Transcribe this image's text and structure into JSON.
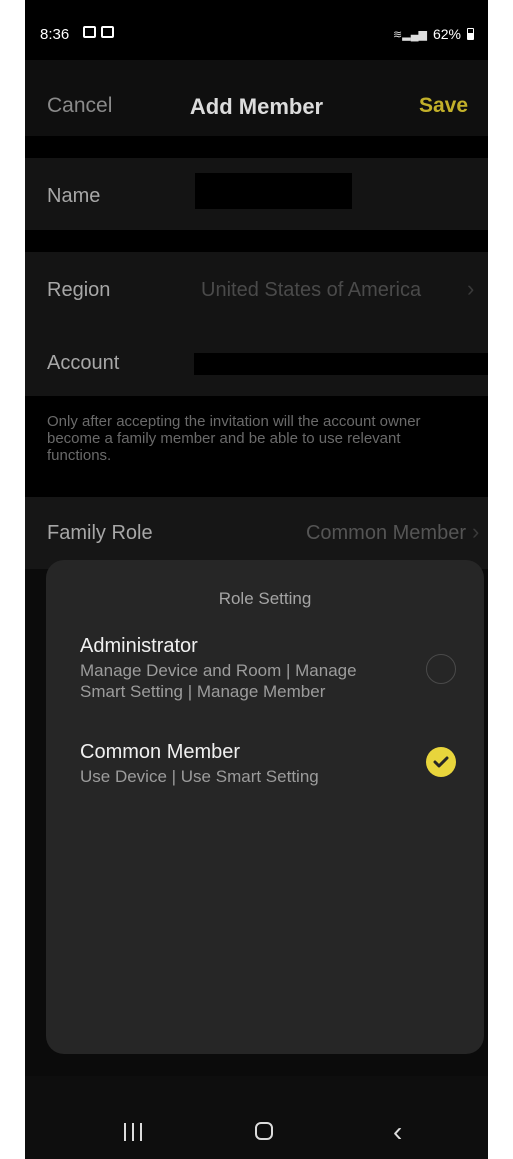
{
  "status_bar": {
    "time": "8:36",
    "battery": "62%"
  },
  "header": {
    "cancel": "Cancel",
    "title": "Add Member",
    "save": "Save"
  },
  "form": {
    "name_label": "Name",
    "region_label": "Region",
    "region_value": "United States of America",
    "account_label": "Account",
    "note": "Only after accepting the invitation will the account owner become a family member and be able to use relevant functions.",
    "family_role_label": "Family Role",
    "family_role_value": "Common Member"
  },
  "role_sheet": {
    "title": "Role Setting",
    "options": [
      {
        "title": "Administrator",
        "desc": "Manage Device and Room | Manage Smart Setting | Manage Member",
        "selected": false
      },
      {
        "title": "Common Member",
        "desc": "Use Device | Use Smart Setting",
        "selected": true
      }
    ]
  },
  "colors": {
    "accent": "#e8d53c",
    "save": "#c2b02a",
    "background": "#000000",
    "sheet": "#262626"
  }
}
